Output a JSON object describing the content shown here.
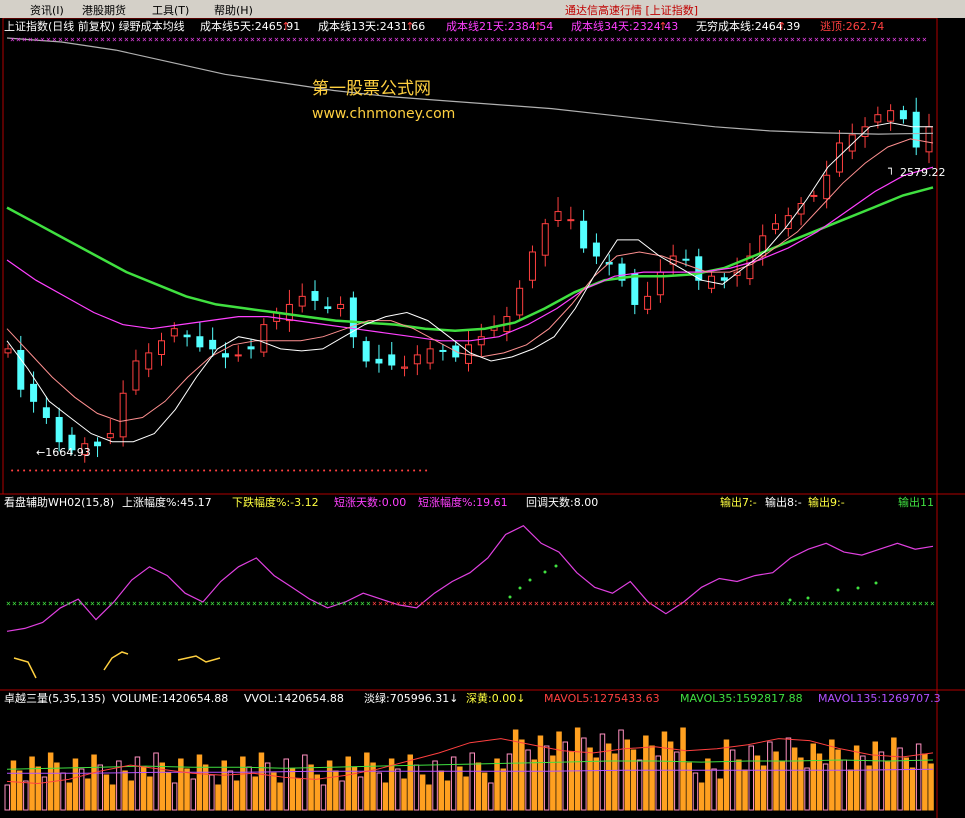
{
  "menu": {
    "items": [
      "资讯(I)",
      "港股期货",
      "工具(T)",
      "帮助(H)"
    ],
    "notice": "通达信高速行情 [上证指数]"
  },
  "watermark": {
    "line1": "第一股票公式网",
    "line2": "www.chnmoney.com"
  },
  "colors": {
    "up": "#ff4040",
    "down": "#54ffff",
    "green": "#40e040",
    "white": "#e8e8e8",
    "cost5": "#ffffff",
    "cost13": "#ff9090",
    "cost21": "#ff40ff",
    "cost34": "#40e040",
    "cost_inf": "#b0b0b0",
    "magenta": "#e040e0",
    "yellow": "#ffd040",
    "orange": "#ffa020",
    "pink": "#ff90c0",
    "axis": "#b00000",
    "purple": "#b050ff"
  },
  "panes": {
    "main": {
      "title": "上证指数(日线 前复权) 绿野成本均线",
      "labels": [
        {
          "text": "成本线5天:2465.91",
          "arrow": "↑",
          "color": "#ffffff"
        },
        {
          "text": "成本线13天:2431.66",
          "arrow": "↑",
          "color": "#ffffff"
        },
        {
          "text": "成本线21天:2384.54",
          "arrow": "↑",
          "color": "#ff40ff"
        },
        {
          "text": "成本线34天:2324.43",
          "arrow": "↑",
          "color": "#ff40ff"
        },
        {
          "text": "无穷成本线:2464.39",
          "arrow": "↑",
          "color": "#ffffff"
        },
        {
          "text": "逃顶:262.74",
          "arrow": "",
          "color": "#ff4040"
        }
      ],
      "high_label": "2579.22",
      "low_label": "←1664.93"
    },
    "aux": {
      "title": "看盘辅助WH02(15,8)",
      "labels": [
        {
          "text": "上涨幅度%:45.17",
          "color": "#ffffff"
        },
        {
          "text": "下跌幅度%:-3.12",
          "color": "#ffff40"
        },
        {
          "text": "短涨天数:0.00",
          "color": "#ff40ff"
        },
        {
          "text": "短涨幅度%:19.61",
          "color": "#ff40ff"
        },
        {
          "text": "回调天数:8.00",
          "color": "#ffffff"
        },
        {
          "text": "输出7:-",
          "color": "#ffff40"
        },
        {
          "text": "输出8:-",
          "color": "#ffffff"
        },
        {
          "text": "输出9:-",
          "color": "#ffff40"
        },
        {
          "text": "输出11",
          "color": "#40e040"
        }
      ]
    },
    "volume": {
      "title": "卓越三量(5,35,135)",
      "labels": [
        {
          "text": "VOLUME:1420654.88",
          "color": "#ffffff"
        },
        {
          "text": "VVOL:1420654.88",
          "color": "#ffffff"
        },
        {
          "text": "淡绿:705996.31↓",
          "color": "#ffffff"
        },
        {
          "text": "深黄:0.00↓",
          "color": "#ffff40"
        },
        {
          "text": "MAVOL5:1275433.63",
          "color": "#ff4040"
        },
        {
          "text": "MAVOL35:1592817.88",
          "color": "#40e040"
        },
        {
          "text": "MAVOL135:1269707.3",
          "color": "#b050ff"
        }
      ]
    }
  },
  "chart_data": {
    "type": "candlestick",
    "price_range": [
      1620,
      2700
    ],
    "high": 2579.22,
    "low": 1664.93,
    "close_path": [
      1930,
      1830,
      1800,
      1760,
      1700,
      1680,
      1695,
      1690,
      1720,
      1820,
      1900,
      1920,
      1950,
      1980,
      1960,
      1935,
      1930,
      1910,
      1915,
      1930,
      1990,
      2020,
      2040,
      2060,
      2050,
      2030,
      2040,
      1960,
      1900,
      1895,
      1890,
      1885,
      1915,
      1930,
      1925,
      1910,
      1940,
      1960,
      1985,
      2010,
      2080,
      2170,
      2240,
      2270,
      2250,
      2180,
      2160,
      2140,
      2100,
      2040,
      2060,
      2120,
      2160,
      2150,
      2100,
      2110,
      2100,
      2120,
      2160,
      2210,
      2240,
      2260,
      2290,
      2310,
      2360,
      2440,
      2460,
      2480,
      2510,
      2520,
      2500,
      2430,
      2480
    ],
    "cost_lines": {
      "cost5": [
        1950,
        1880,
        1800,
        1760,
        1720,
        1700,
        1700,
        1720,
        1780,
        1860,
        1930,
        1960,
        1950,
        1930,
        1925,
        1930,
        1960,
        1990,
        2010,
        2020,
        2000,
        1960,
        1920,
        1900,
        1910,
        1930,
        1960,
        2030,
        2120,
        2200,
        2200,
        2160,
        2130,
        2100,
        2090,
        2130,
        2170,
        2230,
        2300,
        2380,
        2430,
        2480,
        2490,
        2480,
        2480
      ],
      "cost13": [
        1980,
        1920,
        1860,
        1810,
        1770,
        1750,
        1760,
        1800,
        1860,
        1910,
        1940,
        1950,
        1950,
        1950,
        1960,
        1980,
        2000,
        2000,
        1980,
        1950,
        1920,
        1910,
        1920,
        1940,
        1980,
        2040,
        2110,
        2160,
        2170,
        2160,
        2140,
        2120,
        2120,
        2140,
        2180,
        2220,
        2280,
        2340,
        2390,
        2430,
        2450,
        2440
      ],
      "cost21": [
        2150,
        2100,
        2060,
        2020,
        1990,
        1980,
        1990,
        2000,
        2010,
        2010,
        2000,
        1990,
        1980,
        1970,
        1960,
        1950,
        1950,
        1960,
        1990,
        2030,
        2080,
        2110,
        2120,
        2120,
        2120,
        2130,
        2150,
        2180,
        2220,
        2270,
        2320,
        2360,
        2380
      ],
      "cost34": [
        2280,
        2240,
        2200,
        2160,
        2120,
        2090,
        2060,
        2040,
        2030,
        2020,
        2010,
        2000,
        1995,
        1990,
        1980,
        1975,
        1980,
        1995,
        2030,
        2070,
        2100,
        2110,
        2110,
        2115,
        2130,
        2160,
        2190,
        2220,
        2250,
        2280,
        2310,
        2330
      ],
      "cost_inf": [
        2700,
        2690,
        2670,
        2640,
        2610,
        2590,
        2570,
        2555,
        2545,
        2535,
        2525,
        2510,
        2495,
        2480,
        2470,
        2465,
        2462,
        2464
      ]
    },
    "aux_series": {
      "magenta": [
        40,
        42,
        46,
        56,
        62,
        48,
        60,
        75,
        84,
        78,
        66,
        60,
        74,
        84,
        90,
        78,
        70,
        62,
        56,
        60,
        66,
        62,
        58,
        56,
        66,
        74,
        80,
        90,
        106,
        112,
        100,
        94,
        80,
        70,
        66,
        74,
        60,
        52,
        60,
        70,
        76,
        74,
        78,
        80,
        90,
        96,
        100,
        94,
        92,
        96,
        100,
        96,
        98
      ],
      "green_spikes": [
        [
          510,
          597
        ],
        [
          520,
          588
        ],
        [
          530,
          580
        ],
        [
          545,
          572
        ],
        [
          556,
          566
        ],
        [
          790,
          600
        ],
        [
          808,
          598
        ],
        [
          838,
          590
        ],
        [
          858,
          588
        ],
        [
          876,
          583
        ]
      ]
    },
    "volume_series": {
      "ma5": [
        28,
        26,
        30,
        38,
        44,
        40,
        36,
        34,
        36,
        32,
        30,
        34,
        40,
        48,
        56,
        66,
        70,
        64,
        58,
        56,
        60,
        62,
        58,
        60,
        64,
        70,
        68,
        60,
        54,
        52,
        56
      ],
      "ma35": [
        40,
        41,
        42,
        43,
        42,
        42,
        41,
        42,
        43,
        44,
        45,
        46,
        47,
        48,
        48,
        47,
        48,
        48,
        49,
        48,
        49
      ],
      "ma135": [
        36,
        36,
        37,
        37,
        38,
        38,
        38,
        38,
        39,
        39,
        39,
        39,
        40
      ]
    }
  }
}
